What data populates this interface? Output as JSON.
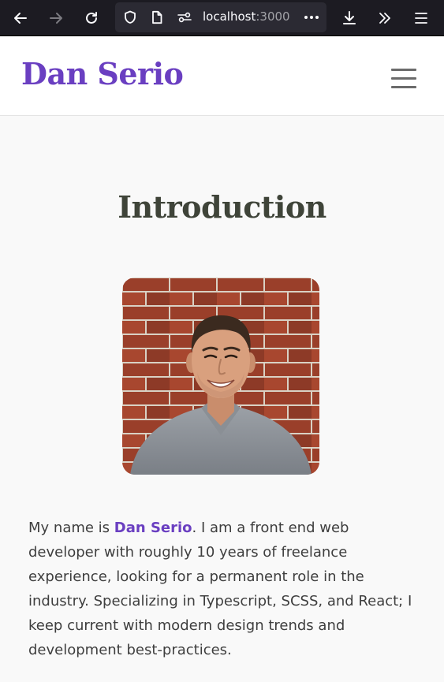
{
  "browser": {
    "url_host": "localhost",
    "url_port": ":3000",
    "icons": {
      "back": "arrow-left-icon",
      "forward": "arrow-right-icon",
      "reload": "reload-icon",
      "shield": "shield-icon",
      "page": "page-icon",
      "permissions": "permissions-icon",
      "more": "more-dots-icon",
      "download": "download-icon",
      "overflow": "chevrons-right-icon",
      "menu": "hamburger-menu-icon"
    }
  },
  "header": {
    "site_title": "Dan Serio",
    "menu_icon": "hamburger-icon"
  },
  "main": {
    "heading": "Introduction",
    "bio": {
      "prefix": "My name is ",
      "name": "Dan Serio",
      "suffix": ". I am a front end web developer with roughly 10 years of freelance experience, looking for a permanent role in the industry. Specializing in Typescript, SCSS, and React; I keep current with modern design trends and development best-practices."
    }
  },
  "colors": {
    "accent": "#6a3fc1",
    "heading": "#3f4439",
    "body_text": "#3e3e3e",
    "page_bg": "#f9f9f9",
    "browser_bg": "#1c1b22",
    "urlbar_bg": "#2b2a33"
  }
}
